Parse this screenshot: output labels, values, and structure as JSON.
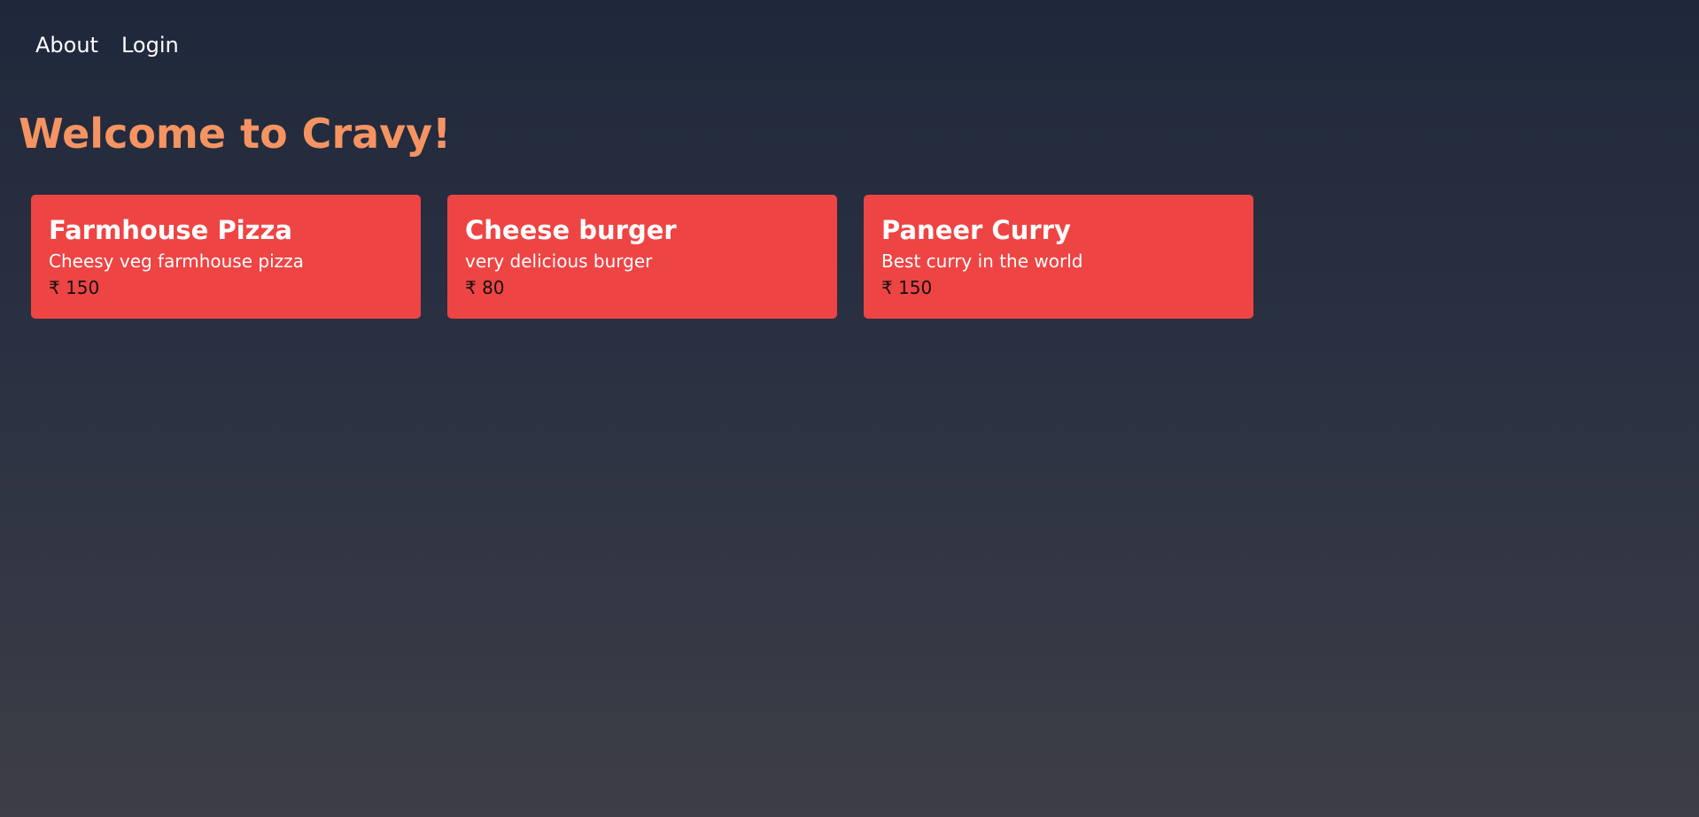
{
  "nav": {
    "items": [
      {
        "label": "About"
      },
      {
        "label": "Login"
      }
    ]
  },
  "page": {
    "title": "Welcome to Cravy!"
  },
  "menu": {
    "items": [
      {
        "name": "Farmhouse Pizza",
        "description": "Cheesy veg farmhouse pizza",
        "price": "₹ 150"
      },
      {
        "name": "Cheese burger",
        "description": "very delicious burger",
        "price": "₹ 80"
      },
      {
        "name": "Paneer Curry",
        "description": "Best curry in the world",
        "price": "₹ 150"
      }
    ]
  },
  "colors": {
    "title": "#f59462",
    "card_background": "#ef4444",
    "background_top": "#1f283b",
    "background_bottom": "#3d3e46"
  }
}
